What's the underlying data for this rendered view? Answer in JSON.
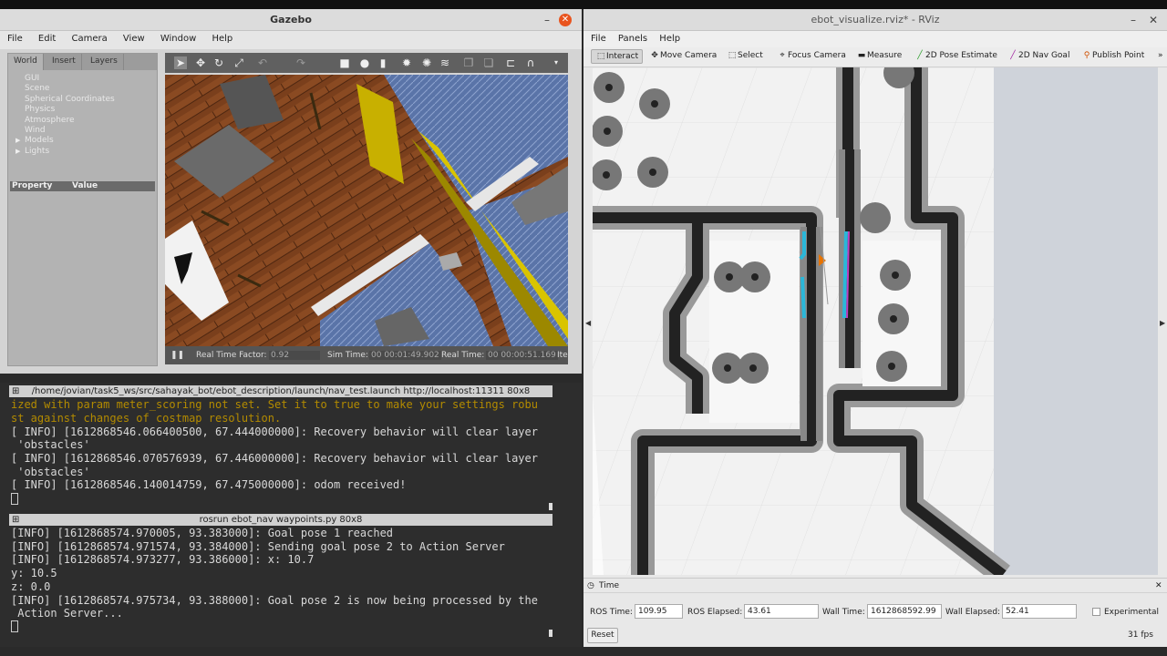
{
  "gazebo": {
    "title": "Gazebo",
    "menu": [
      "File",
      "Edit",
      "Camera",
      "View",
      "Window",
      "Help"
    ],
    "tabs": [
      "World",
      "Insert",
      "Layers"
    ],
    "tree": [
      "GUI",
      "Scene",
      "Spherical Coordinates",
      "Physics",
      "Atmosphere",
      "Wind",
      "Models",
      "Lights"
    ],
    "property_header": {
      "property": "Property",
      "value": "Value"
    },
    "status": {
      "rtf_label": "Real Time Factor:",
      "rtf_value": "0.92",
      "sim_label": "Sim Time:",
      "sim_value": "00 00:01:49.902",
      "real_label": "Real Time:",
      "real_value": "00 00:00:51.169",
      "iter_label": "Ite"
    }
  },
  "terminal1": {
    "title": "/home/jovian/task5_ws/src/sahayak_bot/ebot_description/launch/nav_test.launch http://localhost:11311 80x8",
    "lines": [
      "ized with param meter_scoring not set. Set it to true to make your settings robu",
      "st against changes of costmap resolution.",
      "[ INFO] [1612868546.066400500, 67.444000000]: Recovery behavior will clear layer",
      " 'obstacles'",
      "[ INFO] [1612868546.070576939, 67.446000000]: Recovery behavior will clear layer",
      " 'obstacles'",
      "[ INFO] [1612868546.140014759, 67.475000000]: odom received!"
    ]
  },
  "terminal2": {
    "title": "rosrun ebot_nav waypoints.py 80x8",
    "lines": [
      "[INFO] [1612868574.970005, 93.383000]: Goal pose 1 reached",
      "[INFO] [1612868574.971574, 93.384000]: Sending goal pose 2 to Action Server",
      "[INFO] [1612868574.973277, 93.386000]: x: 10.7",
      "y: 10.5",
      "z: 0.0",
      "[INFO] [1612868574.975734, 93.388000]: Goal pose 2 is now being processed by the",
      " Action Server..."
    ]
  },
  "rviz": {
    "title": "ebot_visualize.rviz* - RViz",
    "menu": [
      "File",
      "Panels",
      "Help"
    ],
    "tools": {
      "interact": "Interact",
      "move_camera": "Move Camera",
      "select": "Select",
      "focus_camera": "Focus Camera",
      "measure": "Measure",
      "pose_estimate": "2D Pose Estimate",
      "nav_goal": "2D Nav Goal",
      "publish_point": "Publish Point"
    },
    "time_panel": {
      "title": "Time",
      "ros_time_label": "ROS Time:",
      "ros_time": "109.95",
      "ros_elapsed_label": "ROS Elapsed:",
      "ros_elapsed": "43.61",
      "wall_time_label": "Wall Time:",
      "wall_time": "1612868592.99",
      "wall_elapsed_label": "Wall Elapsed:",
      "wall_elapsed": "52.41",
      "experimental_label": "Experimental",
      "reset_label": "Reset",
      "fps": "31 fps"
    }
  },
  "colors": {
    "gazebo_close": "#e9541e",
    "floor": "#8a4a22",
    "carpet": "#5a74a8",
    "wall_yellow": "#c8b000",
    "costmap_dark": "#2a2a2a",
    "plan_cyan": "#2ab7d9",
    "plan_magenta": "#c040c0"
  }
}
